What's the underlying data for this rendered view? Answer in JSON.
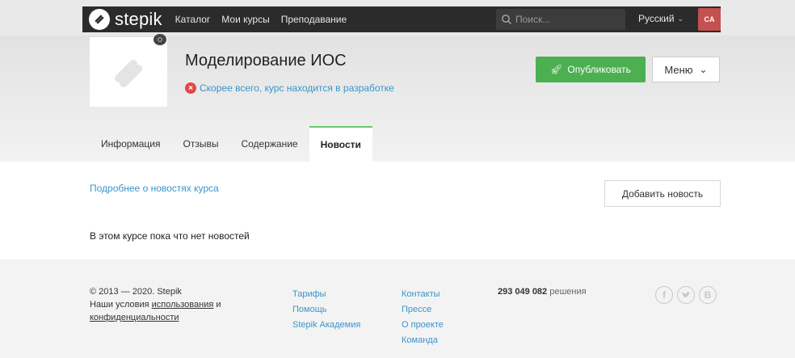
{
  "nav": {
    "brand": "stepik",
    "links": [
      "Каталог",
      "Мои курсы",
      "Преподавание"
    ],
    "search_placeholder": "Поиск...",
    "language": "Русский",
    "avatar_initials": "CA"
  },
  "course": {
    "title": "Моделирование ИОС",
    "status": "Скорее всего, курс находится в разработке",
    "publish_label": "Опубликовать",
    "menu_label": "Меню",
    "tabs": [
      "Информация",
      "Отзывы",
      "Содержание",
      "Новости"
    ],
    "active_tab": "Новости"
  },
  "news": {
    "more_link": "Подробнее о новостях курса",
    "add_button": "Добавить новость",
    "empty_text": "В этом курсе пока что нет новостей"
  },
  "footer": {
    "copyright": "© 2013 — 2020. Stepik",
    "terms_prefix": "Наши условия",
    "terms_link": "использования",
    "terms_and": "и",
    "privacy_link": "конфиденциальности",
    "col1": [
      "Тарифы",
      "Помощь",
      "Stepik Академия"
    ],
    "col2": [
      "Контакты",
      "Прессе",
      "О проекте",
      "Команда"
    ],
    "stats_number": "293 049 082",
    "stats_label": "решения",
    "social": [
      "f",
      "t",
      "B"
    ]
  },
  "colors": {
    "topbar": "#2b2b2b",
    "publish_green": "#4caf50",
    "link_blue": "#3a95c9",
    "avatar": "#c45050",
    "error_red": "#e04848"
  }
}
